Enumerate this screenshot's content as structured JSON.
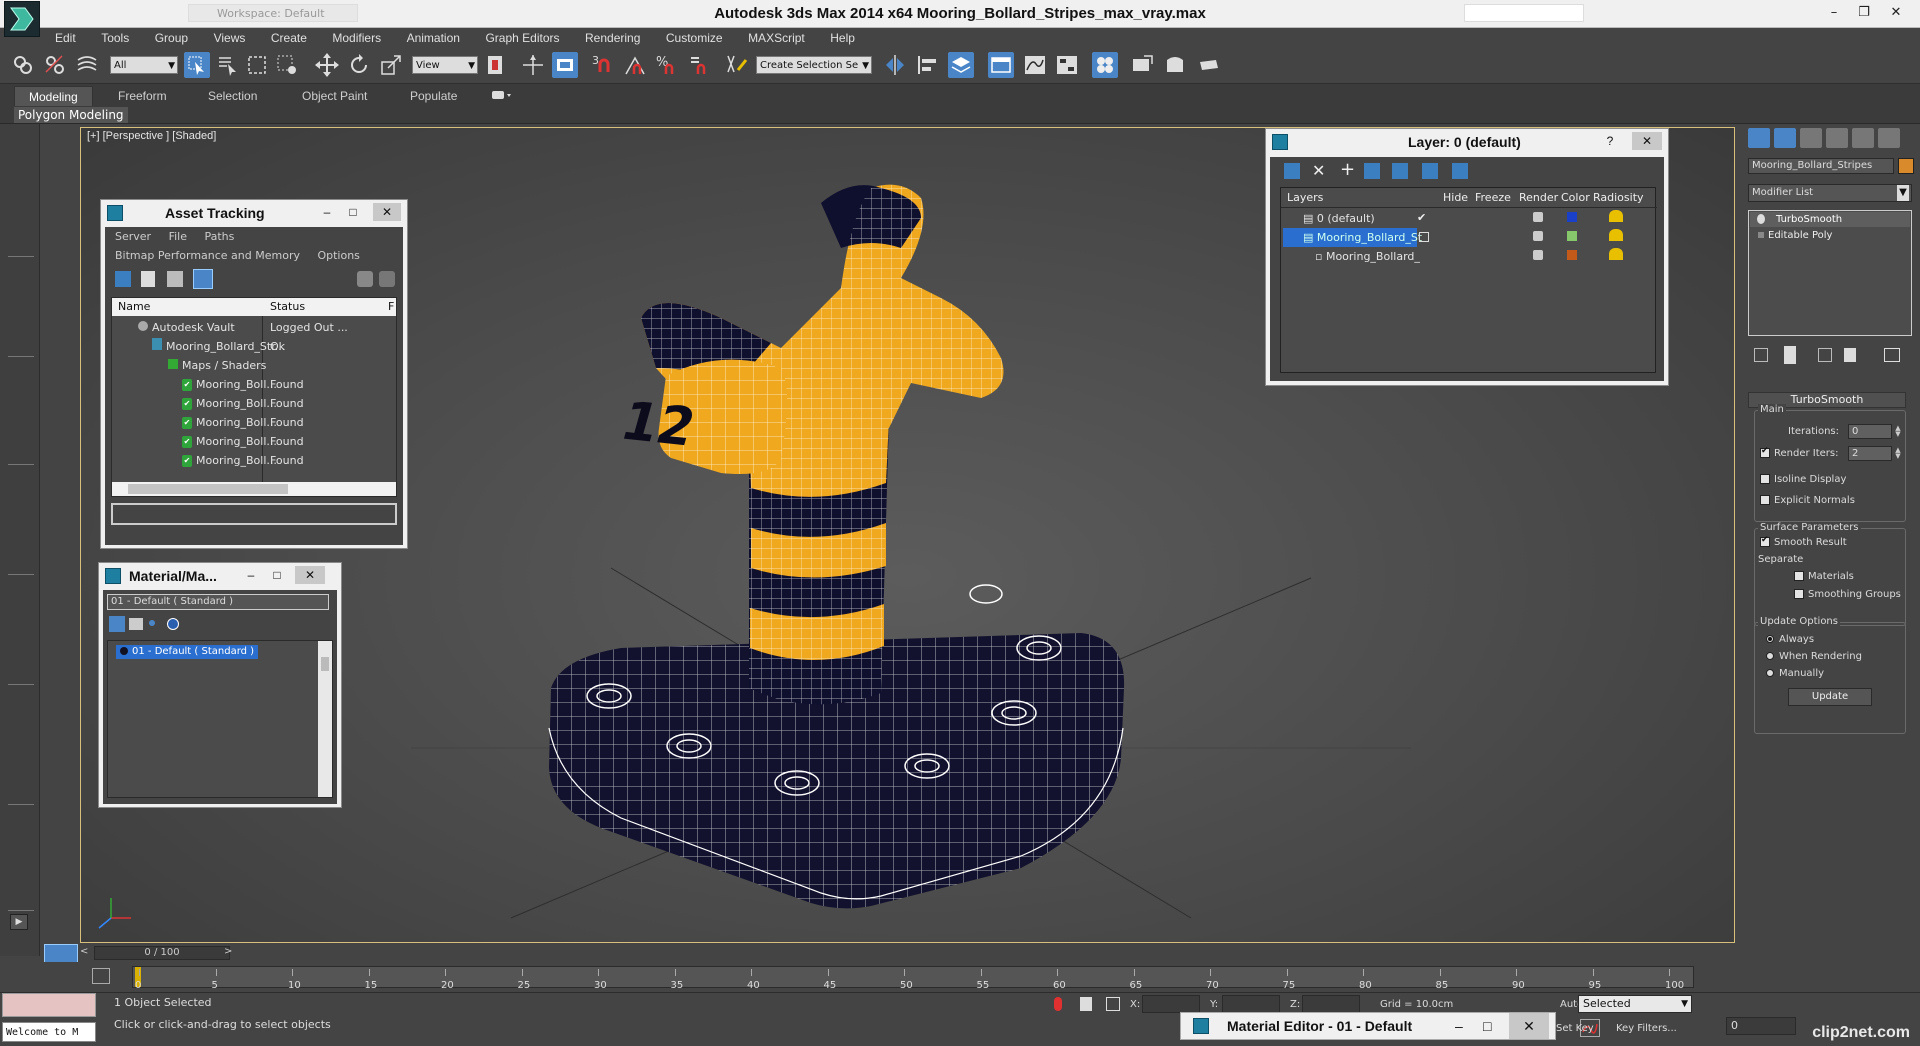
{
  "title": "Autodesk 3ds Max  2014 x64     Mooring_Bollard_Stripes_max_vray.max",
  "workspace": "Workspace: Default",
  "menu": [
    "Edit",
    "Tools",
    "Group",
    "Views",
    "Create",
    "Modifiers",
    "Animation",
    "Graph Editors",
    "Rendering",
    "Customize",
    "MAXScript",
    "Help"
  ],
  "toolbar": {
    "filter": "All",
    "refcoord": "View",
    "selection_set": "Create Selection Se"
  },
  "ribbon": {
    "tabs": [
      "Modeling",
      "Freeform",
      "Selection",
      "Object Paint",
      "Populate"
    ],
    "active": "Modeling",
    "sub_label": "Polygon Modeling"
  },
  "viewport": {
    "label": "[+] [Perspective ] [Shaded]",
    "decal": "12",
    "colors": {
      "stripe_yellow": "#f0a81e",
      "stripe_dark": "#0f0f2e",
      "wire": "#ffffff",
      "grid": "#2c2c2c"
    }
  },
  "asset_tracking": {
    "title": "Asset Tracking",
    "menu1": [
      "Server",
      "File",
      "Paths"
    ],
    "menu2": [
      "Bitmap Performance and Memory",
      "Options"
    ],
    "col_name": "Name",
    "col_status": "Status",
    "col_extra": "F",
    "rows": [
      {
        "name": "Autodesk Vault",
        "status": "Logged Out ..."
      },
      {
        "name": "Mooring_Bollard_Str...",
        "status": "Ok"
      },
      {
        "name": "Maps / Shaders",
        "status": ""
      },
      {
        "name": "Mooring_Boll...",
        "status": "Found"
      },
      {
        "name": "Mooring_Boll...",
        "status": "Found"
      },
      {
        "name": "Mooring_Boll...",
        "status": "Found"
      },
      {
        "name": "Mooring_Boll...",
        "status": "Found"
      },
      {
        "name": "Mooring_Boll...",
        "status": "Found"
      }
    ]
  },
  "material_mini": {
    "title": "Material/Ma...",
    "field": "01 - Default  ( Standard )",
    "item": "01 - Default  ( Standard )"
  },
  "layer_panel": {
    "title": "Layer: 0 (default)",
    "help": "?",
    "headers": [
      "Layers",
      "Hide",
      "Freeze",
      "Render",
      "Color",
      "Radiosity"
    ],
    "rows": [
      {
        "name": "0 (default)",
        "color": "#1a3fc9"
      },
      {
        "name": "Mooring_Bollard_St",
        "color": "#88c86c"
      },
      {
        "name": "Mooring_Bollard_",
        "color": "#c35a1a"
      }
    ]
  },
  "command_panel": {
    "object_name": "Mooring_Bollard_Stripes",
    "object_color": "#d98a2b",
    "modifier_list": "Modifier List",
    "stack": [
      "TurboSmooth",
      "Editable Poly"
    ],
    "rollout_title": "TurboSmooth",
    "main_label": "Main",
    "iterations_label": "Iterations:",
    "iterations_value": "0",
    "render_iters_label": "Render Iters:",
    "render_iters_value": "2",
    "isoline": "Isoline Display",
    "explicit_normals": "Explicit Normals",
    "surface_params": "Surface Parameters",
    "smooth_result": "Smooth Result",
    "separate": "Separate",
    "materials": "Materials",
    "smoothing_groups": "Smoothing Groups",
    "update_options": "Update Options",
    "always": "Always",
    "when_rendering": "When Rendering",
    "manually": "Manually",
    "update_button": "Update"
  },
  "timeline": {
    "slider": "0 / 100",
    "ticks": [
      "0",
      "5",
      "10",
      "15",
      "20",
      "25",
      "30",
      "35",
      "40",
      "45",
      "50",
      "55",
      "60",
      "65",
      "70",
      "75",
      "80",
      "85",
      "90",
      "95",
      "100"
    ]
  },
  "status": {
    "selected": "1 Object Selected",
    "prompt": "Click or click-and-drag to select objects",
    "x_label": "X:",
    "y_label": "Y:",
    "z_label": "Z:",
    "grid": "Grid = 10.0cm",
    "auto_key": "Auto Key",
    "set_key": "Set Key",
    "key_mode": "Selected",
    "key_filters": "Key Filters...",
    "frame": "0",
    "listener": "Welcome to M"
  },
  "material_editor_bar": "Material Editor - 01 - Default",
  "watermark": "clip2net.com"
}
